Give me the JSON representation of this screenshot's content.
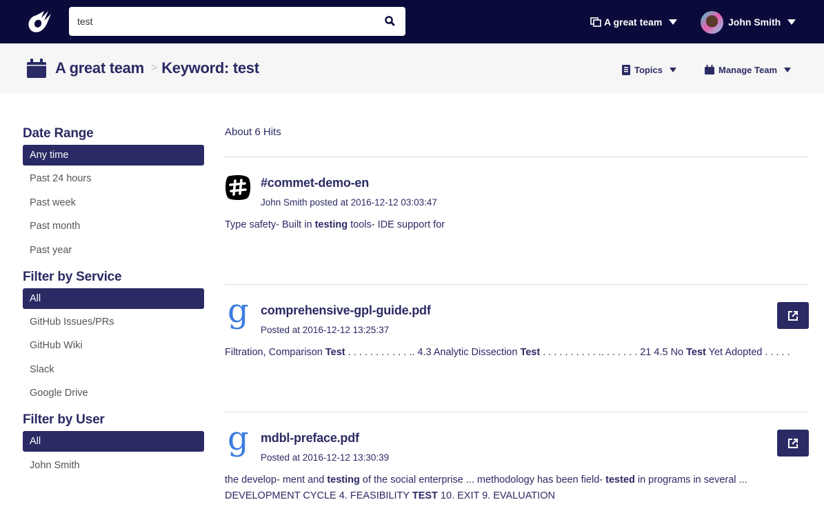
{
  "topbar": {
    "logo": "comet-logo-icon",
    "search": {
      "value": "test",
      "placeholder": "",
      "icon": "search-icon"
    },
    "team_switcher": {
      "label": "A great team",
      "icon": "windows-icon"
    },
    "user_menu": {
      "name": "John Smith",
      "avatar": "avatar"
    }
  },
  "subheader": {
    "breadcrumb": {
      "icon": "calendar-icon",
      "team": "A great team",
      "separator": ">",
      "current": "Keyword: test"
    },
    "topics_menu": {
      "label": "Topics",
      "icon": "book-icon"
    },
    "manage_menu": {
      "label": "Manage Team",
      "icon": "calendar-icon"
    }
  },
  "sidebar": {
    "date_range": {
      "heading": "Date Range",
      "items": [
        {
          "label": "Any time",
          "active": true
        },
        {
          "label": "Past 24 hours",
          "active": false
        },
        {
          "label": "Past week",
          "active": false
        },
        {
          "label": "Past month",
          "active": false
        },
        {
          "label": "Past year",
          "active": false
        }
      ]
    },
    "service": {
      "heading": "Filter by Service",
      "items": [
        {
          "label": "All",
          "active": true
        },
        {
          "label": "GitHub Issues/PRs",
          "active": false
        },
        {
          "label": "GitHub Wiki",
          "active": false
        },
        {
          "label": "Slack",
          "active": false
        },
        {
          "label": "Google Drive",
          "active": false
        }
      ]
    },
    "user": {
      "heading": "Filter by User",
      "items": [
        {
          "label": "All",
          "active": true
        },
        {
          "label": "John Smith",
          "active": false
        }
      ]
    }
  },
  "results": {
    "hits_label": "About 6 Hits",
    "items": [
      {
        "service": "slack",
        "icon": "slack-icon",
        "title": "#commet-demo-en",
        "meta": "John Smith posted at 2016-12-12 03:03:47",
        "snippet": [
          {
            "t": "Type safety- Built in ",
            "b": false
          },
          {
            "t": "testing",
            "b": true
          },
          {
            "t": " tools- IDE support for",
            "b": false
          }
        ],
        "has_open_button": false
      },
      {
        "service": "google-drive",
        "icon": "google-g-icon",
        "title": "comprehensive-gpl-guide.pdf",
        "meta": "Posted at 2016-12-12 13:25:37",
        "snippet": [
          {
            "t": "Filtration, Comparison ",
            "b": false
          },
          {
            "t": "Test",
            "b": true
          },
          {
            "t": " . . . . . . . . . . . .. 4.3 Analytic Dissection ",
            "b": false
          },
          {
            "t": "Test",
            "b": true
          },
          {
            "t": " . . . . . . . . . . .. . . . . . . 21 4.5 No ",
            "b": false
          },
          {
            "t": "Test",
            "b": true
          },
          {
            "t": " Yet Adopted . . . . .",
            "b": false
          }
        ],
        "has_open_button": true
      },
      {
        "service": "google-drive",
        "icon": "google-g-icon",
        "title": "mdbl-preface.pdf",
        "meta": "Posted at 2016-12-12 13:30:39",
        "snippet": [
          {
            "t": "the develop- ment and ",
            "b": false
          },
          {
            "t": "testing",
            "b": true
          },
          {
            "t": " of the social enterprise ... methodology has been field- ",
            "b": false
          },
          {
            "t": "tested",
            "b": true
          },
          {
            "t": " in programs in several ... DEVELOPMENT CYCLE 4. FEASIBILITY ",
            "b": false
          },
          {
            "t": "TEST",
            "b": true
          },
          {
            "t": " 10. EXIT 9. EVALUATION",
            "b": false
          }
        ],
        "has_open_button": true
      }
    ]
  },
  "colors": {
    "topbar_bg": "#0b0b3b",
    "primary": "#2a2a64",
    "subheader_bg": "#f6f6f6",
    "google_blue": "#3b7de0"
  }
}
